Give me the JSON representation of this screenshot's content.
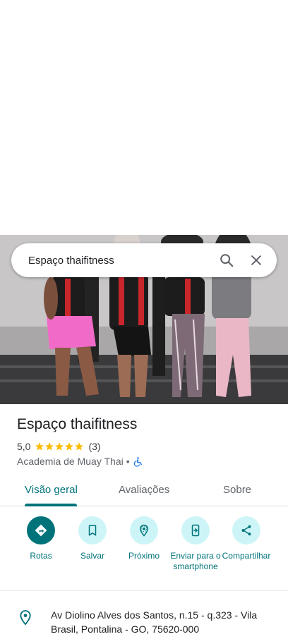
{
  "search": {
    "query": "Espaço thaifitness"
  },
  "place": {
    "name": "Espaço thaifitness",
    "rating": "5,0",
    "stars": 5,
    "review_count": "(3)",
    "category": "Academia de Muay Thai",
    "separator": "•"
  },
  "tabs": [
    {
      "label": "Visão geral",
      "active": true
    },
    {
      "label": "Avaliações",
      "active": false
    },
    {
      "label": "Sobre",
      "active": false
    }
  ],
  "actions": [
    {
      "label": "Rotas",
      "icon": "directions-icon"
    },
    {
      "label": "Salvar",
      "icon": "bookmark-icon"
    },
    {
      "label": "Próximo",
      "icon": "nearby-icon"
    },
    {
      "label": "Enviar para o smartphone",
      "icon": "send-to-phone-icon"
    },
    {
      "label": "Compartilhar",
      "icon": "share-icon"
    }
  ],
  "address": {
    "text": "Av Diolino Alves dos Santos, n.15 - q.323 - Vila Brasil, Pontalina - GO, 75620-000"
  },
  "colors": {
    "accent": "#00737a",
    "accent_light": "#cdf5f7",
    "star": "#fbbc04",
    "accessibility": "#1a73e8"
  }
}
